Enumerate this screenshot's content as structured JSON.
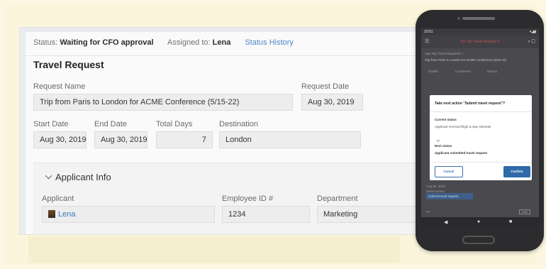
{
  "status": {
    "status_label": "Status:",
    "status_value": "Waiting for CFO approval",
    "assigned_label": "Assigned to:",
    "assigned_value": "Lena",
    "history_link": "Status History"
  },
  "form": {
    "title": "Travel Request",
    "request_name_label": "Request Name",
    "request_name_value": "Trip from Paris to London for ACME Conference (5/15-22)",
    "request_date_label": "Request Date",
    "request_date_value": "Aug 30, 2019",
    "start_date_label": "Start Date",
    "start_date_value": "Aug 30, 2019",
    "end_date_label": "End Date",
    "end_date_value": "Aug 30, 2019",
    "total_days_label": "Total Days",
    "total_days_value": "7",
    "destination_label": "Destination",
    "destination_value": "London"
  },
  "applicant_section": {
    "heading": "Applicant Info",
    "applicant_label": "Applicant",
    "applicant_value": "Lena",
    "employee_id_label": "Employee ID #",
    "employee_id_value": "1234",
    "department_label": "Department",
    "department_value": "Marketing"
  },
  "phone": {
    "time": "10:51",
    "status_icons": "▾◢▮",
    "app_title": "Re: My Travel Request ▾",
    "breadcrumb": "App: My Travel Requests >",
    "record_title": "Trip from Paris to London for ACME Conference (5/15-22)",
    "tabs": [
      "Details",
      "Comments",
      "History"
    ],
    "bg_date": "Aug 30, 2019",
    "bg_action_label": "Select action",
    "bg_action_button": "Submit travel request",
    "bg_edit": "Edit",
    "dialog": {
      "title": "Take next action \"Submit travel request\"?",
      "current_label": "Current status",
      "current_value": "Applicant received flight & stay estimate",
      "next_label": "Next status",
      "next_value": "Applicant submitted travel request",
      "cancel": "Cancel",
      "confirm": "Confirm"
    },
    "nav": {
      "back": "◀",
      "home": "●",
      "recent": "■"
    }
  }
}
